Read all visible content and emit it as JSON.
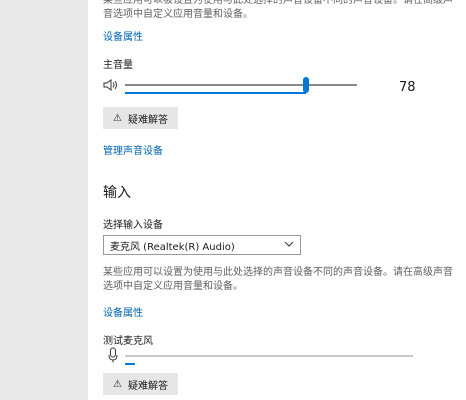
{
  "output": {
    "desc_cut": "某些应用可以被设置为使用与此处选择的声音设备不同的声音设备。请在高级声音选项中自定义应用音量和设备。",
    "device_properties": "设备属性",
    "volume_label": "主音量",
    "volume_value": "78",
    "volume_level": 78,
    "speaker_icon": "speaker-icon",
    "troubleshoot": "疑难解答",
    "manage_devices": "管理声音设备"
  },
  "input": {
    "section_title": "输入",
    "choose_label": "选择输入设备",
    "selected_device": "麦克风 (Realtek(R) Audio)",
    "desc": "某些应用可以设置为使用与此处选择的声音设备不同的声音设备。请在高级声音选项中自定义应用音量和设备。",
    "device_properties": "设备属性",
    "test_label": "测试麦克风",
    "mic_level": 3,
    "mic_icon": "microphone-icon",
    "troubleshoot": "疑难解答"
  },
  "colors": {
    "accent": "#0078d7",
    "link": "#0063b1",
    "sidebar": "#e9e9e9",
    "button": "#e6e6e6"
  }
}
